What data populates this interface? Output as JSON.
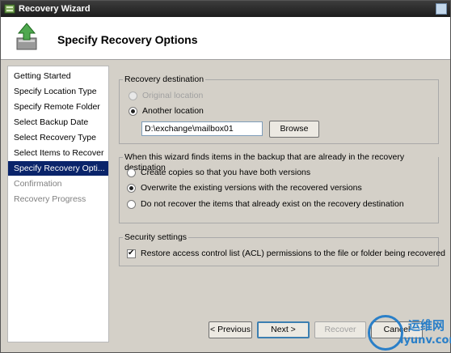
{
  "window": {
    "title": "Recovery Wizard"
  },
  "header": {
    "title": "Specify Recovery Options"
  },
  "nav": {
    "items": [
      {
        "label": "Getting Started"
      },
      {
        "label": "Specify Location Type"
      },
      {
        "label": "Specify Remote Folder"
      },
      {
        "label": "Select Backup Date"
      },
      {
        "label": "Select Recovery Type"
      },
      {
        "label": "Select Items to Recover"
      },
      {
        "label": "Specify Recovery Opti..."
      },
      {
        "label": "Confirmation"
      },
      {
        "label": "Recovery Progress"
      }
    ],
    "active_index": 6
  },
  "recovery_destination": {
    "group_label": "Recovery destination",
    "option_original": "Original location",
    "option_another": "Another location",
    "path_value": "D:\\exchange\\mailbox01",
    "browse_label": "Browse"
  },
  "conflict": {
    "group_label": "When this wizard finds items in the backup that are already in the recovery destination",
    "option_copies": "Create copies so that you have both versions",
    "option_overwrite": "Overwrite the existing versions with the recovered versions",
    "option_skip": "Do not recover the items that already exist on the recovery destination"
  },
  "security": {
    "group_label": "Security settings",
    "restore_acl_label": "Restore access control list (ACL) permissions to the file or folder being recovered"
  },
  "footer": {
    "previous_label": "< Previous",
    "next_label": "Next >",
    "recover_label": "Recover",
    "cancel_label": "Cancel"
  },
  "watermark": {
    "cn": "运维网",
    "url": "iyunv.com"
  },
  "colors": {
    "active_nav": "#0a246a",
    "title_bar": "#2b2b2b",
    "default_button_border": "#3c7fb1"
  }
}
